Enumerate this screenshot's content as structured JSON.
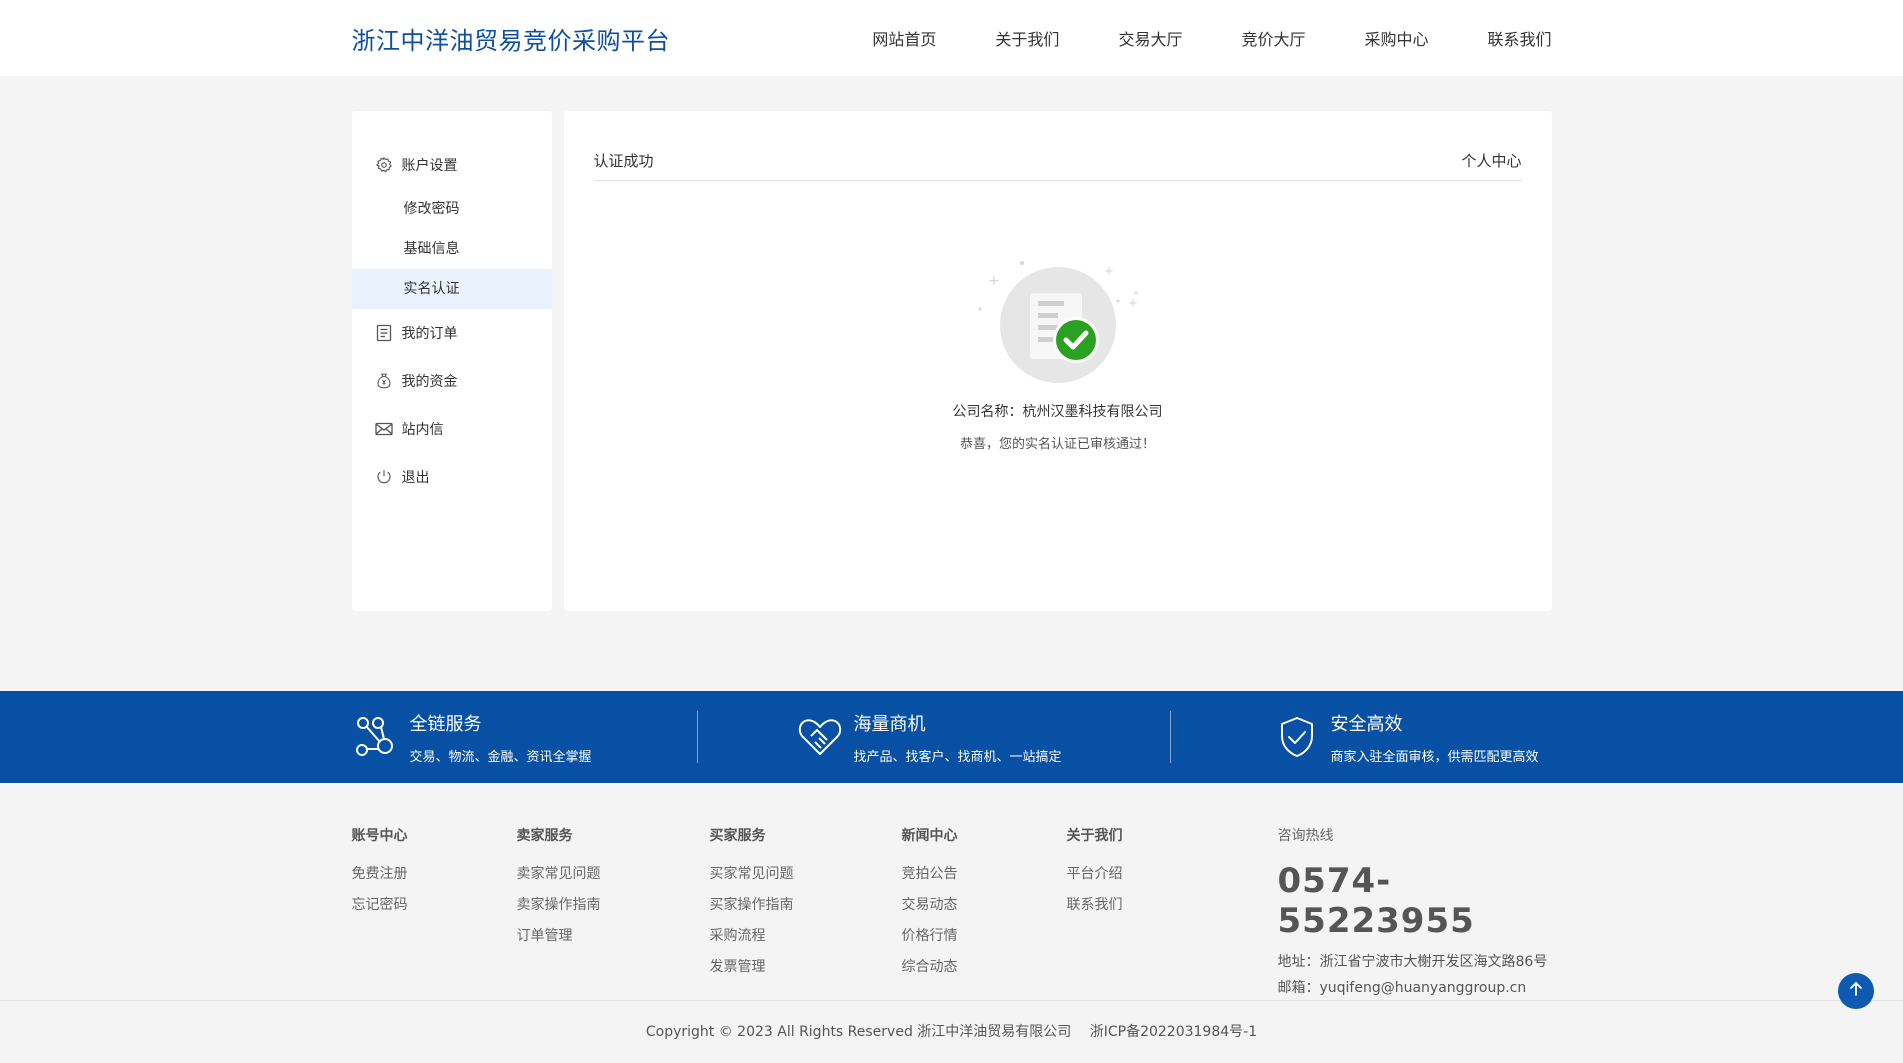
{
  "header": {
    "logo": "浙江中洋油贸易竞价采购平台",
    "nav": [
      "网站首页",
      "关于我们",
      "交易大厅",
      "竞价大厅",
      "采购中心",
      "联系我们"
    ]
  },
  "sidebar": {
    "account_settings": "账户设置",
    "change_password": "修改密码",
    "basic_info": "基础信息",
    "real_name_auth": "实名认证",
    "my_orders": "我的订单",
    "my_funds": "我的资金",
    "inbox": "站内信",
    "logout": "退出"
  },
  "content": {
    "title": "认证成功",
    "personal_center": "个人中心",
    "company_line": "公司名称：杭州汉墨科技有限公司",
    "congrats": "恭喜，您的实名认证已审核通过！"
  },
  "band": {
    "features": [
      {
        "title": "全链服务",
        "desc": "交易、物流、金融、资讯全掌握",
        "icon": "network-icon"
      },
      {
        "title": "海量商机",
        "desc": "找产品、找客户、找商机、一站搞定",
        "icon": "handshake-heart-icon"
      },
      {
        "title": "安全高效",
        "desc": "商家入驻全面审核，供需匹配更高效",
        "icon": "shield-check-icon"
      }
    ]
  },
  "footer": {
    "columns": [
      {
        "title": "账号中心",
        "links": [
          "免费注册",
          "忘记密码"
        ]
      },
      {
        "title": "卖家服务",
        "links": [
          "卖家常见问题",
          "卖家操作指南",
          "订单管理"
        ]
      },
      {
        "title": "买家服务",
        "links": [
          "买家常见问题",
          "买家操作指南",
          "采购流程",
          "发票管理"
        ]
      },
      {
        "title": "新闻中心",
        "links": [
          "竞拍公告",
          "交易动态",
          "价格行情",
          "综合动态"
        ]
      },
      {
        "title": "关于我们",
        "links": [
          "平台介绍",
          "联系我们"
        ]
      }
    ],
    "hotline_label": "咨询热线",
    "hotline": "0574-55223955",
    "address": "地址：浙江省宁波市大榭开发区海文路86号",
    "email": "邮箱：yuqifeng@huanyanggroup.cn",
    "copyright": "Copyright © 2023 All Rights Reserved 浙江中洋油贸易有限公司 　浙ICP备2022031984号-1"
  },
  "colors": {
    "brand": "#0750a4",
    "active_bg": "#e9f1fc",
    "success": "#2aa120"
  }
}
